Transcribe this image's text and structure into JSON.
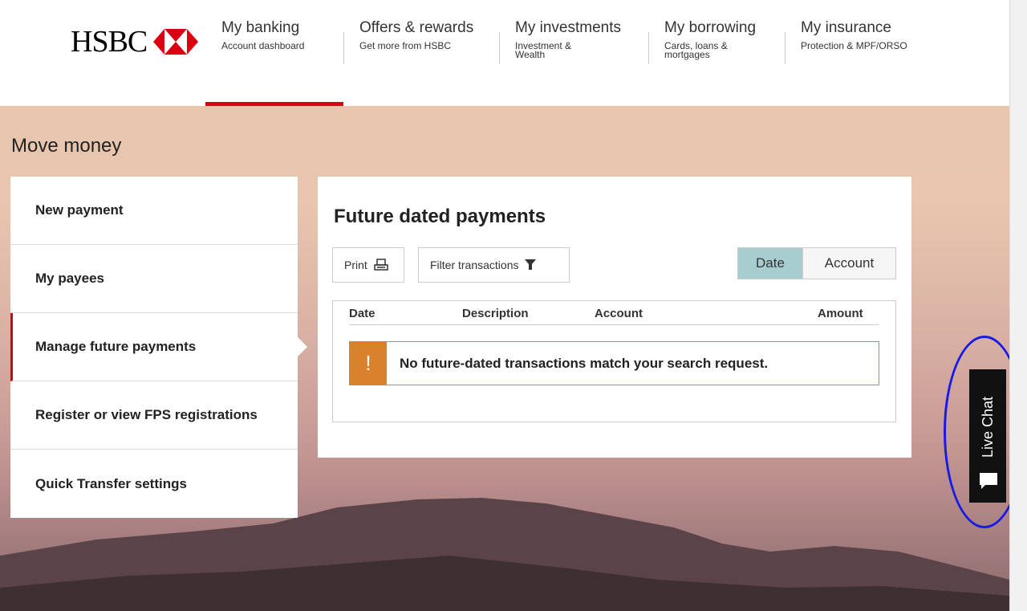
{
  "header": {
    "logo_text": "HSBC",
    "nav": [
      {
        "title": "My banking",
        "sub": "Account dashboard"
      },
      {
        "title": "Offers & rewards",
        "sub": "Get more from HSBC"
      },
      {
        "title": "My investments",
        "sub": "Investment & Wealth"
      },
      {
        "title": "My borrowing",
        "sub": "Cards, loans & mortgages"
      },
      {
        "title": "My insurance",
        "sub": "Protection & MPF/ORSO"
      }
    ]
  },
  "page": {
    "title": "Move money"
  },
  "side_menu": {
    "items": [
      {
        "label": "New payment"
      },
      {
        "label": "My payees"
      },
      {
        "label": "Manage future payments"
      },
      {
        "label": "Register or view FPS registrations"
      },
      {
        "label": "Quick Transfer settings"
      }
    ]
  },
  "panel": {
    "title": "Future dated payments",
    "print_label": "Print",
    "filter_label": "Filter transactions",
    "sort": {
      "date": "Date",
      "account": "Account"
    },
    "columns": {
      "date": "Date",
      "description": "Description",
      "account": "Account",
      "amount": "Amount"
    },
    "alert_icon": "!",
    "alert_text": "No future-dated transactions match your search request."
  },
  "live_chat": {
    "label": "Live Chat",
    "icon": "chat-bubble-icon"
  },
  "colors": {
    "brand_red": "#db0011",
    "warning_orange": "#d9822b",
    "selected_sort": "#a8cdd0"
  }
}
